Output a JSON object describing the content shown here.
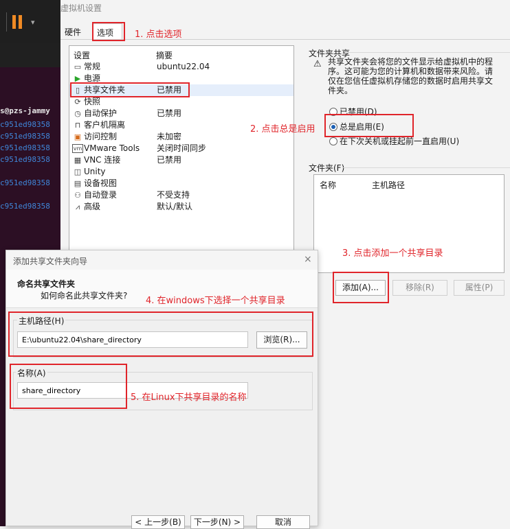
{
  "terminal": {
    "dropdown_glyph": "▾",
    "user_line": "s@pzs-jammy",
    "hash_lines": [
      "c951ed98358",
      "c951ed98358",
      "c951ed98358",
      "c951ed98358",
      "",
      "c951ed98358",
      "",
      "c951ed98358"
    ]
  },
  "vm_settings": {
    "window_title": "虚拟机设置",
    "tabs": [
      "硬件",
      "选项"
    ],
    "list_headers": {
      "setting": "设置",
      "summary": "摘要"
    },
    "items": [
      {
        "icon": "monitor-icon",
        "glyph": "▭",
        "name": "常规",
        "summary": "ubuntu22.04"
      },
      {
        "icon": "power-play-icon",
        "glyph": "▶",
        "name": "电源",
        "summary": ""
      },
      {
        "icon": "shared-folder-icon",
        "glyph": "▯",
        "name": "共享文件夹",
        "summary": "已禁用"
      },
      {
        "icon": "snapshot-icon",
        "glyph": "⟳",
        "name": "快照",
        "summary": ""
      },
      {
        "icon": "auto-protect-icon",
        "glyph": "◷",
        "name": "自动保护",
        "summary": "已禁用"
      },
      {
        "icon": "lock-icon",
        "glyph": "⊓",
        "name": "客户机隔离",
        "summary": ""
      },
      {
        "icon": "access-control-icon",
        "glyph": "▣",
        "name": "访问控制",
        "summary": "未加密"
      },
      {
        "icon": "vmware-tools-icon",
        "glyph": "vm",
        "name": "VMware Tools",
        "summary": "关闭时间同步"
      },
      {
        "icon": "vnc-icon",
        "glyph": "▦",
        "name": "VNC 连接",
        "summary": "已禁用"
      },
      {
        "icon": "unity-icon",
        "glyph": "◫",
        "name": "Unity",
        "summary": ""
      },
      {
        "icon": "device-view-icon",
        "glyph": "▤",
        "name": "设备视图",
        "summary": ""
      },
      {
        "icon": "auto-login-icon",
        "glyph": "⚇",
        "name": "自动登录",
        "summary": "不受支持"
      },
      {
        "icon": "advanced-icon",
        "glyph": "⩘",
        "name": "高级",
        "summary": "默认/默认"
      }
    ],
    "shared_folders": {
      "group_title": "文件夹共享",
      "warning_icon": "warning-icon",
      "warning_text": "共享文件夹会将您的文件显示给虚拟机中的程序。这可能为您的计算机和数据带来风险。请仅在您信任虚拟机存储您的数据时启用共享文件夹。",
      "options": [
        {
          "label": "已禁用(D)",
          "selected": false
        },
        {
          "label": "总是启用(E)",
          "selected": true
        },
        {
          "label": "在下次关机或挂起前一直启用(U)",
          "selected": false
        }
      ],
      "folders_title": "文件夹(F)",
      "table_headers": {
        "name": "名称",
        "host_path": "主机路径"
      },
      "buttons": {
        "add": "添加(A)...",
        "remove": "移除(R)",
        "properties": "属性(P)"
      }
    }
  },
  "wizard": {
    "title": "添加共享文件夹向导",
    "close_glyph": "×",
    "heading": "命名共享文件夹",
    "subheading": "如何命名此共享文件夹?",
    "host_path_label": "主机路径(H)",
    "host_path_value": "E:\\ubuntu22.04\\share_directory",
    "browse_label": "浏览(R)...",
    "name_label": "名称(A)",
    "name_value": "share_directory",
    "buttons": {
      "back": "< 上一步(B)",
      "next": "下一步(N) >",
      "cancel": "取消"
    }
  },
  "annotations": {
    "step1": "1. 点击选项",
    "step2": "2. 点击总是启用",
    "step3": "3. 点击添加一个共享目录",
    "step4": "4. 在windows下选择一个共享目录",
    "step5": "5. 在Linux下共享目录的名称",
    "color": "#e0242a"
  },
  "colors": {
    "accent": "#1a5fb4",
    "terminal_bg": "#2c0f24",
    "terminal_text": "#3f86d9",
    "pause": "#f08a24"
  }
}
